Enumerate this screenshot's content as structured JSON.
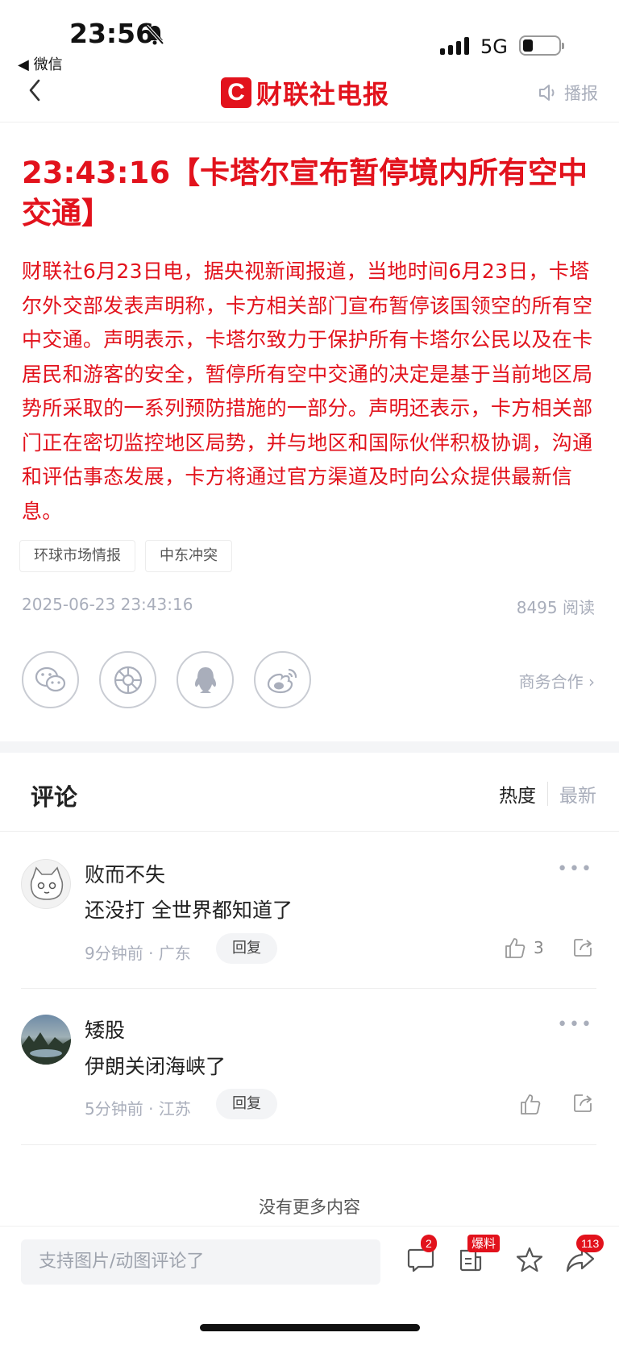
{
  "status_bar": {
    "time": "23:56",
    "back_app": "◀ 微信",
    "network": "5G"
  },
  "nav": {
    "logo_mark": "C",
    "logo_text_part1": "财联社",
    "logo_text_part2": "电报",
    "broadcast_label": "播报"
  },
  "article": {
    "headline": "23:43:16【卡塔尔宣布暂停境内所有空中交通】",
    "body": "财联社6月23日电，据央视新闻报道，当地时间6月23日，卡塔尔外交部发表声明称，卡方相关部门宣布暂停该国领空的所有空中交通。声明表示，卡塔尔致力于保护所有卡塔尔公民以及在卡居民和游客的安全，暂停所有空中交通的决定是基于当前地区局势所采取的一系列预防措施的一部分。声明还表示，卡方相关部门正在密切监控地区局势，并与地区和国际伙伴积极协调，沟通和评估事态发展，卡方将通过官方渠道及时向公众提供最新信息。",
    "tags": [
      "环球市场情报",
      "中东冲突"
    ],
    "publish_time": "2025-06-23 23:43:16",
    "reads": "8495 阅读",
    "business_link": "商务合作 ›",
    "share_icons": [
      "wechat-icon",
      "moments-icon",
      "qq-icon",
      "weibo-icon"
    ]
  },
  "comments_section": {
    "title": "评论",
    "sort_hot": "热度",
    "sort_new": "最新",
    "items": [
      {
        "user": "败而不失",
        "text": "还没打 全世界都知道了",
        "meta": "9分钟前 · 广东",
        "reply_label": "回复",
        "likes": "3"
      },
      {
        "user": "矮股",
        "text": "伊朗关闭海峡了",
        "meta": "5分钟前 · 江苏",
        "reply_label": "回复",
        "likes": ""
      }
    ],
    "no_more": "没有更多内容"
  },
  "bottom_bar": {
    "input_placeholder": "支持图片/动图评论了",
    "comment_count": "2",
    "tip_tag": "爆料",
    "share_count": "113"
  },
  "colors": {
    "brand_red": "#e2121c",
    "muted_gray": "#a9aebb"
  }
}
